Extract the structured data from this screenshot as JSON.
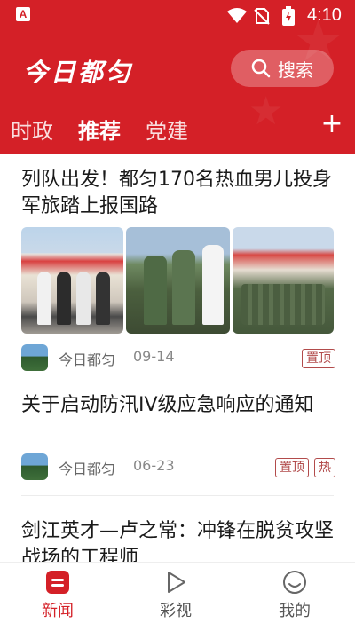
{
  "status_bar": {
    "time": "4:10",
    "app_icon_letter": "A"
  },
  "header": {
    "logo": "今日都匀",
    "search_label": "搜索",
    "tabs": [
      {
        "label": "时政",
        "active": false
      },
      {
        "label": "推荐",
        "active": true
      },
      {
        "label": "党建",
        "active": false
      }
    ],
    "add_tab_label": "+"
  },
  "articles": [
    {
      "title": "列队出发！都匀170名热血男儿投身军旅踏上报国路",
      "source": "今日都匀",
      "date": "09-14",
      "badges": [
        "置顶"
      ],
      "images": 3
    },
    {
      "title": "关于启动防汛IV级应急响应的通知",
      "source": "今日都匀",
      "date": "06-23",
      "badges": [
        "置顶",
        "热"
      ]
    },
    {
      "title": "剑江英才—卢之常：冲锋在脱贫攻坚战场的工程师"
    }
  ],
  "bottom_nav": [
    {
      "label": "新闻",
      "active": true
    },
    {
      "label": "彩视",
      "active": false
    },
    {
      "label": "我的",
      "active": false
    }
  ],
  "colors": {
    "brand_red": "#d42027",
    "badge_red": "#b24b4b"
  }
}
